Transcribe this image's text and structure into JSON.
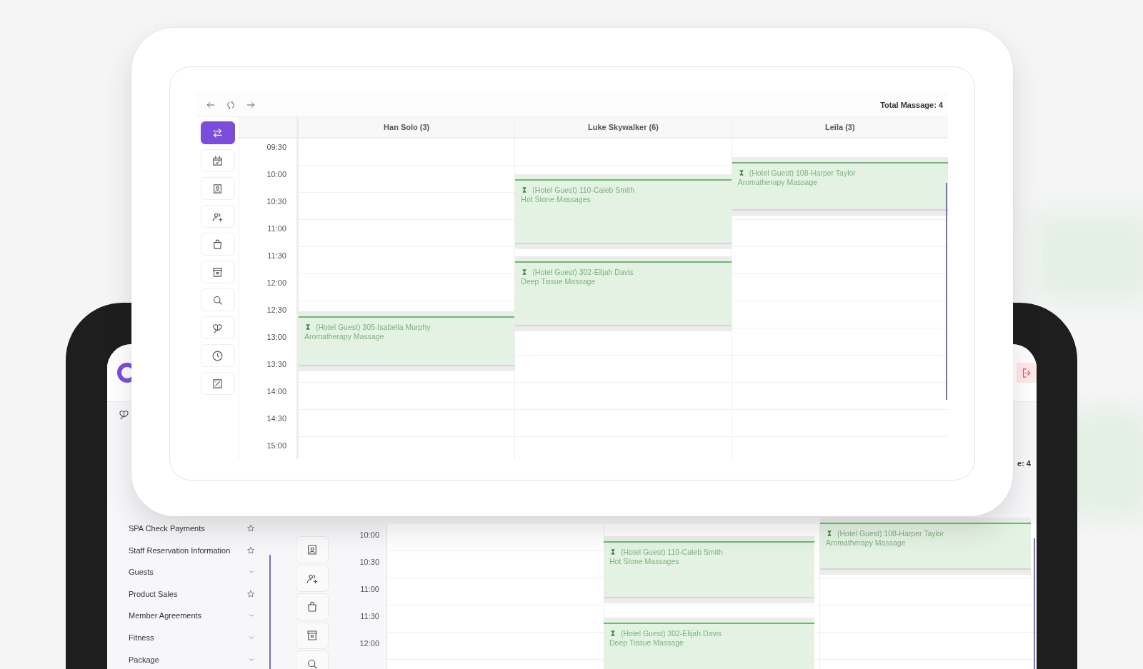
{
  "card": {
    "nav": [
      {
        "kind": "back"
      },
      {
        "kind": "refresh"
      },
      {
        "kind": "forward"
      }
    ],
    "total": "Total Massage: 4",
    "tools": [
      {
        "kind": "swap",
        "selected": true
      },
      {
        "kind": "calendar",
        "selected": false
      },
      {
        "kind": "contact",
        "selected": false
      },
      {
        "kind": "userplus",
        "selected": false
      },
      {
        "kind": "bag",
        "selected": false
      },
      {
        "kind": "archive",
        "selected": false
      },
      {
        "kind": "search",
        "selected": false
      },
      {
        "kind": "leaves",
        "selected": false
      },
      {
        "kind": "clock",
        "selected": false
      },
      {
        "kind": "percent",
        "selected": false
      }
    ],
    "times": [
      "09:30",
      "10:00",
      "10:30",
      "11:00",
      "11:30",
      "12:00",
      "12:30",
      "13:00",
      "13:30",
      "14:00",
      "14:30",
      "15:00"
    ],
    "staff": [
      {
        "name": "Han Solo (3)",
        "bookings": [
          {
            "guest": "(Hotel Guest) 305-Isabella Murphy",
            "service": "Aromatherapy Massage"
          }
        ]
      },
      {
        "name": "Luke Skywalker (6)",
        "bookings": [
          {
            "guest": "(Hotel Guest) 110-Caleb Smith",
            "service": "Hot Stone Massages"
          },
          {
            "guest": "(Hotel Guest) 302-Elijah Davis",
            "service": "Deep Tissue Massage"
          }
        ]
      },
      {
        "name": "Leila (3)",
        "bookings": [
          {
            "guest": "(Hotel Guest) 108-Harper Taylor",
            "service": "Aromatherapy Massage"
          }
        ]
      }
    ]
  },
  "tablet": {
    "sidebar": [
      {
        "label": "SPA Check Payments",
        "kind": "favorite"
      },
      {
        "label": "Staff Reservation Information",
        "kind": "favorite"
      },
      {
        "label": "Guests",
        "kind": "group"
      },
      {
        "label": "Product Sales",
        "kind": "favorite"
      },
      {
        "label": "Member Agreements",
        "kind": "group"
      },
      {
        "label": "Fitness",
        "kind": "group"
      },
      {
        "label": "Package",
        "kind": "group"
      }
    ],
    "total": "e: 4",
    "tools": [
      {
        "kind": "contact"
      },
      {
        "kind": "userplus"
      },
      {
        "kind": "bag"
      },
      {
        "kind": "archive"
      },
      {
        "kind": "search"
      }
    ],
    "times": [
      "10:00",
      "10:30",
      "11:00",
      "11:30",
      "12:00"
    ],
    "bookings": [
      {
        "guest": "(Hotel Guest) 110-Caleb Smith",
        "service": "Hot Stone Massages"
      },
      {
        "guest": "(Hotel Guest) 302-Elijah Davis",
        "service": "Deep Tissue Massage"
      },
      {
        "guest": "(Hotel Guest) 108-Harper Taylor",
        "service": "Aromatherapy Massage"
      }
    ]
  }
}
